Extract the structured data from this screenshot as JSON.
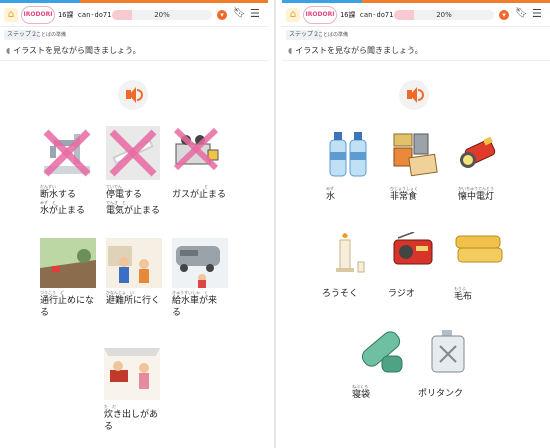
{
  "header": {
    "lesson": "16課 can-do71",
    "progress_percent": 20,
    "progress_text": "20%",
    "logo_text": "IRODORI",
    "accent": "#ef7d2c",
    "progress_blue": "#3aa1e6"
  },
  "step": {
    "label": "ステップ２",
    "sub": "ことばの準備"
  },
  "instruction": "イラストを見ながら聞きましょう。",
  "left_items": [
    {
      "furigana": "だんすい",
      "lines": [
        "断水する",
        "水が止まる"
      ],
      "furigana2": "みず　と"
    },
    {
      "furigana": "ていでん",
      "lines": [
        "停電する",
        "電気が止まる"
      ],
      "furigana2": "でんき　と"
    },
    {
      "furigana": "と",
      "lines": [
        "ガスが止まる"
      ]
    },
    {
      "furigana": "つうこう　ど",
      "lines": [
        "通行止めにな",
        "る"
      ]
    },
    {
      "furigana": "ひなんじょ　い",
      "lines": [
        "避難所に行く"
      ]
    },
    {
      "furigana": "きゅうすいしゃ　く",
      "lines": [
        "給水車が来",
        "る"
      ]
    },
    {
      "furigana": "た　だ",
      "lines": [
        "炊き出しがあ",
        "る"
      ]
    }
  ],
  "right_items": [
    {
      "furigana": "みず",
      "lines": [
        "水"
      ]
    },
    {
      "furigana": "ひじょうしょく",
      "lines": [
        "非常食"
      ]
    },
    {
      "furigana": "かいちゅうでんとう",
      "lines": [
        "懐中電灯"
      ]
    },
    {
      "furigana": "",
      "lines": [
        "ろうそく"
      ]
    },
    {
      "furigana": "",
      "lines": [
        "ラジオ"
      ]
    },
    {
      "furigana": "もうふ",
      "lines": [
        "毛布"
      ]
    },
    {
      "furigana": "ねぶくろ",
      "lines": [
        "寝袋"
      ]
    },
    {
      "furigana": "",
      "lines": [
        "ポリタンク"
      ]
    }
  ],
  "icons": [
    "home-icon",
    "bookmark-icon",
    "menu-icon",
    "hint-icon",
    "ear-icon",
    "speaker-icon"
  ]
}
